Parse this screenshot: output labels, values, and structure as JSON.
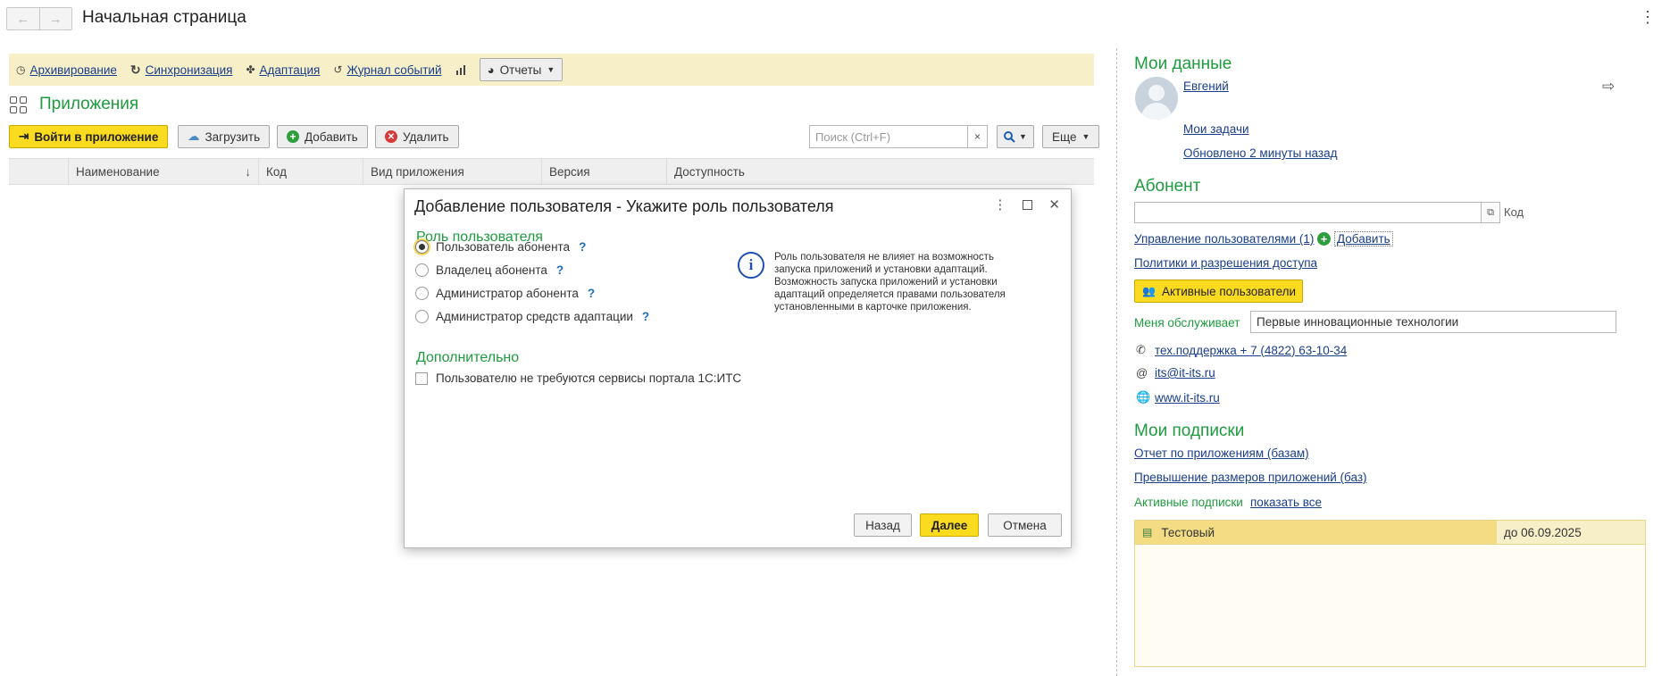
{
  "window": {
    "title": "Начальная страница",
    "back_icon": "←",
    "forward_icon": "→"
  },
  "commands": {
    "archive": "Архивирование",
    "sync": "Синхронизация",
    "adapt": "Адаптация",
    "log": "Журнал событий",
    "reports": "Отчеты"
  },
  "apps": {
    "title": "Приложения",
    "toolbar": {
      "enter": "Войти в приложение",
      "upload": "Загрузить",
      "add": "Добавить",
      "delete": "Удалить",
      "search_placeholder": "Поиск (Ctrl+F)",
      "clear": "×",
      "more": "Еще"
    },
    "columns": [
      "Наименование",
      "Код",
      "Вид приложения",
      "Версия",
      "Доступность"
    ],
    "sort_indicator": "↓"
  },
  "dialog": {
    "title": "Добавление пользователя - Укажите роль пользователя",
    "role_section": "Роль пользователя",
    "roles": [
      {
        "label": "Пользователь абонента",
        "help": "?",
        "selected": true
      },
      {
        "label": "Владелец абонента",
        "help": "?",
        "selected": false
      },
      {
        "label": "Администратор абонента",
        "help": "?",
        "selected": false
      },
      {
        "label": "Администратор средств адаптации",
        "help": "?",
        "selected": false
      }
    ],
    "info_icon": "i",
    "info_text": "Роль пользователя не влияет на возможность запуска приложений и установки адаптаций. Возможность запуска приложений и установки адаптаций определяется правами пользователя установленными в карточке приложения.",
    "extra_section": "Дополнительно",
    "checkbox_label": "Пользователю не требуются сервисы портала 1С:ИТС",
    "checkbox_checked": false,
    "buttons": {
      "back": "Назад",
      "next": "Далее",
      "cancel": "Отмена"
    }
  },
  "my_data": {
    "title": "Мои данные",
    "user": "Евгений",
    "tasks": "Мои задачи",
    "updated": "Обновлено 2 минуты назад"
  },
  "subscriber": {
    "title": "Абонент",
    "code_label": "Код",
    "manage_users": "Управление пользователями (1)",
    "add": "Добавить",
    "policies": "Политики и разрешения доступа",
    "active_users": "Активные пользователи",
    "served_by_label": "Меня обслуживает",
    "served_by": "Первые инновационные технологии",
    "phone": "тех.поддержка + 7 (4822) 63-10-34",
    "email": "its@it-its.ru",
    "site": "www.it-its.ru"
  },
  "subscriptions": {
    "title": "Мои подписки",
    "report_apps": "Отчет по приложениям (базам)",
    "exceed": "Превышение размеров приложений (баз)",
    "active_label": "Активные подписки",
    "show_all": "показать все",
    "rows": [
      {
        "name": "Тестовый",
        "until": "до 06.09.2025"
      }
    ]
  },
  "colors": {
    "accent_green": "#1e9b3e",
    "primary_yellow": "#fbdb1f",
    "link_blue": "#1a3e8c",
    "command_bar": "#f6efc8"
  }
}
